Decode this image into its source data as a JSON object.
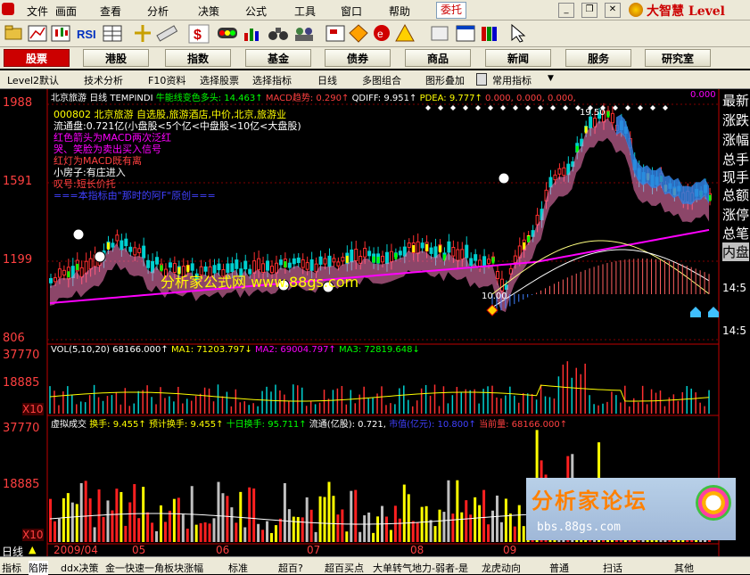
{
  "menu": {
    "items": [
      "文件",
      "画面",
      "查看",
      "分析",
      "决策",
      "公式",
      "工具",
      "窗口",
      "帮助"
    ],
    "entrust": "委托",
    "brand": "大智慧 Level"
  },
  "nav": {
    "tabs": [
      "股票",
      "港股",
      "指数",
      "基金",
      "债券",
      "商品",
      "新闻",
      "服务",
      "研究室"
    ],
    "active": "股票"
  },
  "subtabs": [
    "Level2默认",
    "技术分析",
    "F10资料",
    "选择股票",
    "选择指标",
    "日线",
    "多图组合",
    "图形叠加",
    "常用指标"
  ],
  "main": {
    "title_stock": "北京旅游",
    "title_period": "日线",
    "indicator": "TEMPINDI",
    "legend_a": "牛能线变色多头: 14.463↑",
    "legend_b": "MACD趋势: 0.290↑",
    "legend_c": "QDIFF: 9.951↑",
    "legend_d": "PDEA: 9.777↑",
    "legend_e": "0.000, 0.000, 0.000,",
    "legend_f": "0.000",
    "info_1": "000802 北京旅游 自选股,旅游酒店,中价,北京,旅游业",
    "info_2": "流通盘:0.721亿(小盘股<5个亿<中盘股<10亿<大盘股)",
    "info_3": "红色箭头为MACD两次泛红",
    "info_4": "哭、笑脸为卖出买入信号",
    "info_5": "红灯为MACD既有离",
    "info_6": "小房子:有庄进入",
    "info_7": "叹号:短长价托",
    "info_8": "===本指标由\"那时的阿F\"原创===",
    "watermark": "分析家公式网 www.88gs.com",
    "high_label": "19.50",
    "low_label": "10.00",
    "y_labels": [
      "1988",
      "1591",
      "1199",
      "806"
    ],
    "right_labels": [
      "最新",
      "涨跌",
      "涨幅",
      "总手",
      "现手",
      "总额",
      "涨停",
      "总笔",
      "内盘"
    ],
    "right_time": "14:5"
  },
  "vol": {
    "legend": "VOL(5,10,20)",
    "legend_v": "68166.000↑",
    "ma1": "MA1: 71203.797↓",
    "ma2": "MA2: 69004.797↑",
    "ma3": "MA3: 72819.648↓",
    "y_labels": [
      "37770",
      "18885"
    ],
    "scale": "X10"
  },
  "virt": {
    "legend": "虚拟成交",
    "turnover": "换手: 9.455↑",
    "pred": "预计换手: 9.455↑",
    "ten": "十日换手: 95.711↑",
    "float": "流通(亿股): 0.721,",
    "mcap": "市值(亿元): 10.800↑",
    "curvol": "当前量: 68166.000↑",
    "y_labels": [
      "37770",
      "18885"
    ],
    "scale": "X10",
    "logo": "分析家论坛",
    "logo_url": "bbs.88gs.com"
  },
  "xaxis": {
    "labels": [
      "2009/04",
      "05",
      "06",
      "07",
      "08",
      "09"
    ],
    "period": "日线"
  },
  "status": {
    "items": [
      "指标",
      "陷阱",
      "ddx决策",
      "金一快速一角",
      "板块涨幅",
      "标准",
      "超百?",
      "超百买点",
      "大单转气地力-弱者-是",
      "龙虎动向",
      "普通",
      "扫话",
      "其他"
    ]
  },
  "colors": {
    "up": "#ff3030",
    "down": "#00d0d0",
    "axis": "#c00000",
    "label_red": "#ff4040",
    "yellow": "#ffff00",
    "green": "#00ff00",
    "magenta": "#ff00ff"
  }
}
